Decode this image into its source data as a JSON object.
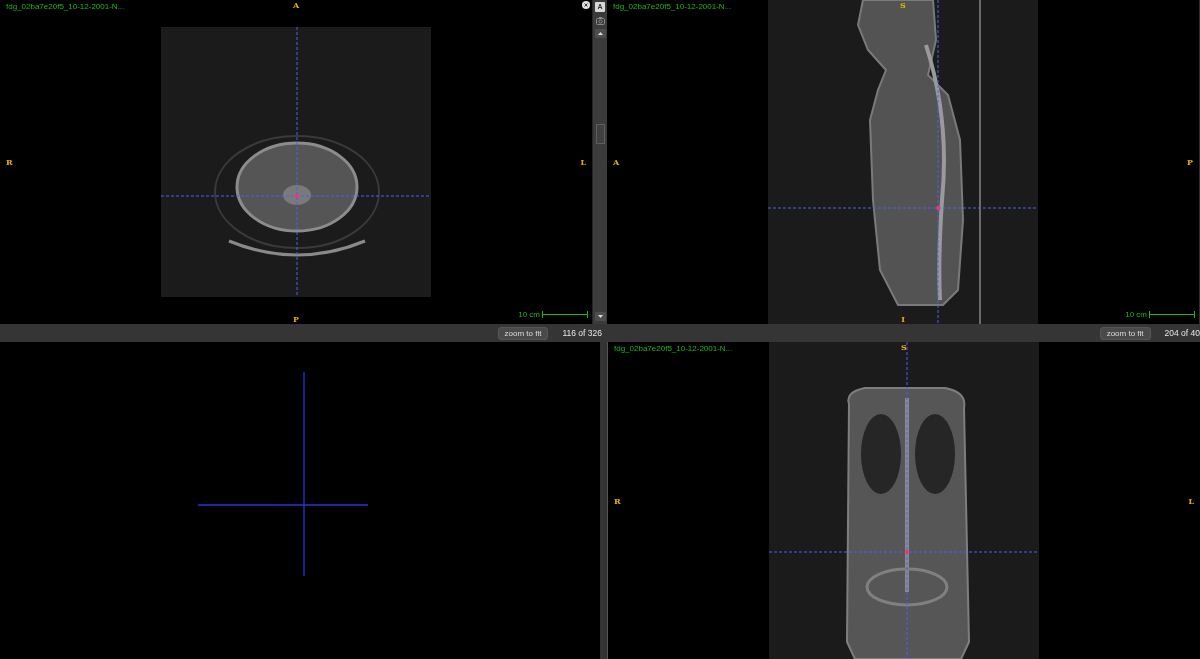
{
  "viewports": [
    {
      "kind": "axial",
      "title": "fdg_02ba7e20f5_10-12-2001-N...",
      "orientation": {
        "top": "A",
        "left": "R",
        "right": "L",
        "bottom": "P"
      },
      "scale": "10 cm"
    },
    {
      "kind": "sagittal",
      "title": "fdg_02ba7e20f5_10-12-2001-N...",
      "orientation": {
        "top": "S",
        "left": "A",
        "right": "P",
        "bottom": "I"
      },
      "scale": "10 cm"
    },
    {
      "kind": "blank"
    },
    {
      "kind": "coronal",
      "title": "fdg_02ba7e20f5_10-12-2001-N...",
      "orientation": {
        "top": "S",
        "left": "R",
        "right": "L"
      }
    }
  ],
  "side_toolbar": {
    "label_button": "A"
  },
  "footers": [
    {
      "button": "zoom to fit",
      "slice": "116 of 326"
    },
    {
      "button": "zoom to fit",
      "slice": "204 of 40"
    }
  ]
}
